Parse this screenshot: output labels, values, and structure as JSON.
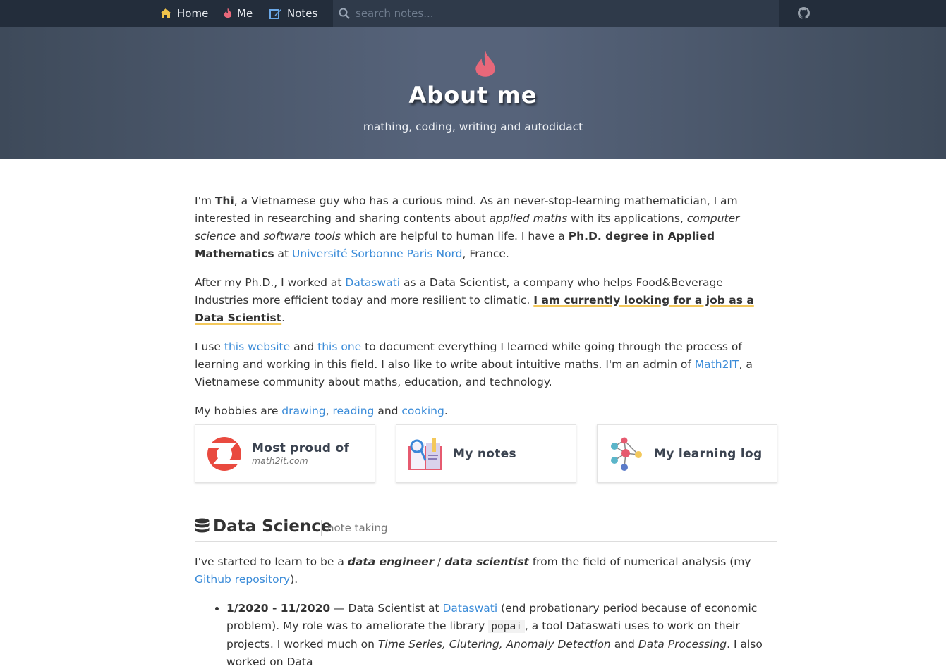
{
  "nav": {
    "home": "Home",
    "me": "Me",
    "notes": "Notes",
    "search_placeholder": "search notes..."
  },
  "hero": {
    "title": "About me",
    "subtitle": "mathing, coding, writing and autodidact"
  },
  "about": {
    "p1": {
      "a": "I'm ",
      "name": "Thi",
      "b": ", a Vietnamese guy who has a curious mind. As an never-stop-learning mathematician, I am interested in researching and sharing contents about ",
      "i1": "applied maths",
      "c": " with its applications, ",
      "i2": "computer science",
      "d": " and ",
      "i3": "software tools",
      "e": " which are helpful to human life. I have a ",
      "degree": "Ph.D. degree in Applied Mathematics",
      "f": " at ",
      "univ_link": "Université Sorbonne Paris Nord",
      "g": ", France."
    },
    "p2": {
      "a": "After my Ph.D., I worked at ",
      "link": "Dataswati",
      "b": " as a Data Scientist, a company who helps Food&Beverage Industries more efficient today and more resilient to climatic. ",
      "highlight": "I am currently looking for a job as a Data Scientist",
      "c": "."
    },
    "p3": {
      "a": "I use ",
      "link1": "this website",
      "b": " and ",
      "link2": "this one",
      "c": " to document everything I learned while going through the process of learning and working in this field. I also like to write about intuitive maths. I'm an admin of ",
      "link3": "Math2IT",
      "d": ", a Vietnamese community about maths, education, and technology."
    },
    "p4": {
      "a": "My hobbies are ",
      "link1": "drawing",
      "b": ", ",
      "link2": "reading",
      "c": " and ",
      "link3": "cooking",
      "d": "."
    }
  },
  "cards": [
    {
      "title": "Most proud of",
      "subtitle": "math2it.com",
      "icon": "math2it-logo-icon"
    },
    {
      "title": "My notes",
      "icon": "notebook-icon"
    },
    {
      "title": "My learning log",
      "icon": "network-graph-icon"
    }
  ],
  "section": {
    "title": "Data Science",
    "subtitle": "note taking",
    "intro": {
      "a": "I've started to learn to be a ",
      "i1": "data engineer",
      "b": " / ",
      "i2": "data scientist",
      "c": " from the field of numerical analysis (my ",
      "link": "Github repository",
      "d": ")."
    },
    "item1": {
      "date": "1/2020 - 11/2020",
      "a": " — Data Scientist at ",
      "link": "Dataswati",
      "b": " (end probationary period because of economic problem). My role was to ameliorate the library ",
      "code": "popai",
      "c": ", a tool Dataswati uses to work on their projects. I worked much on ",
      "i1": "Time Series, Clutering, Anomaly Detection",
      "d": " and ",
      "i2": "Data Processing",
      "e": ". I also worked on Data"
    }
  },
  "colors": {
    "nav_bg": "#232d3b",
    "accent_flame": "#e8687a",
    "link": "#3a8bd8",
    "highlight": "#f3c85b"
  }
}
